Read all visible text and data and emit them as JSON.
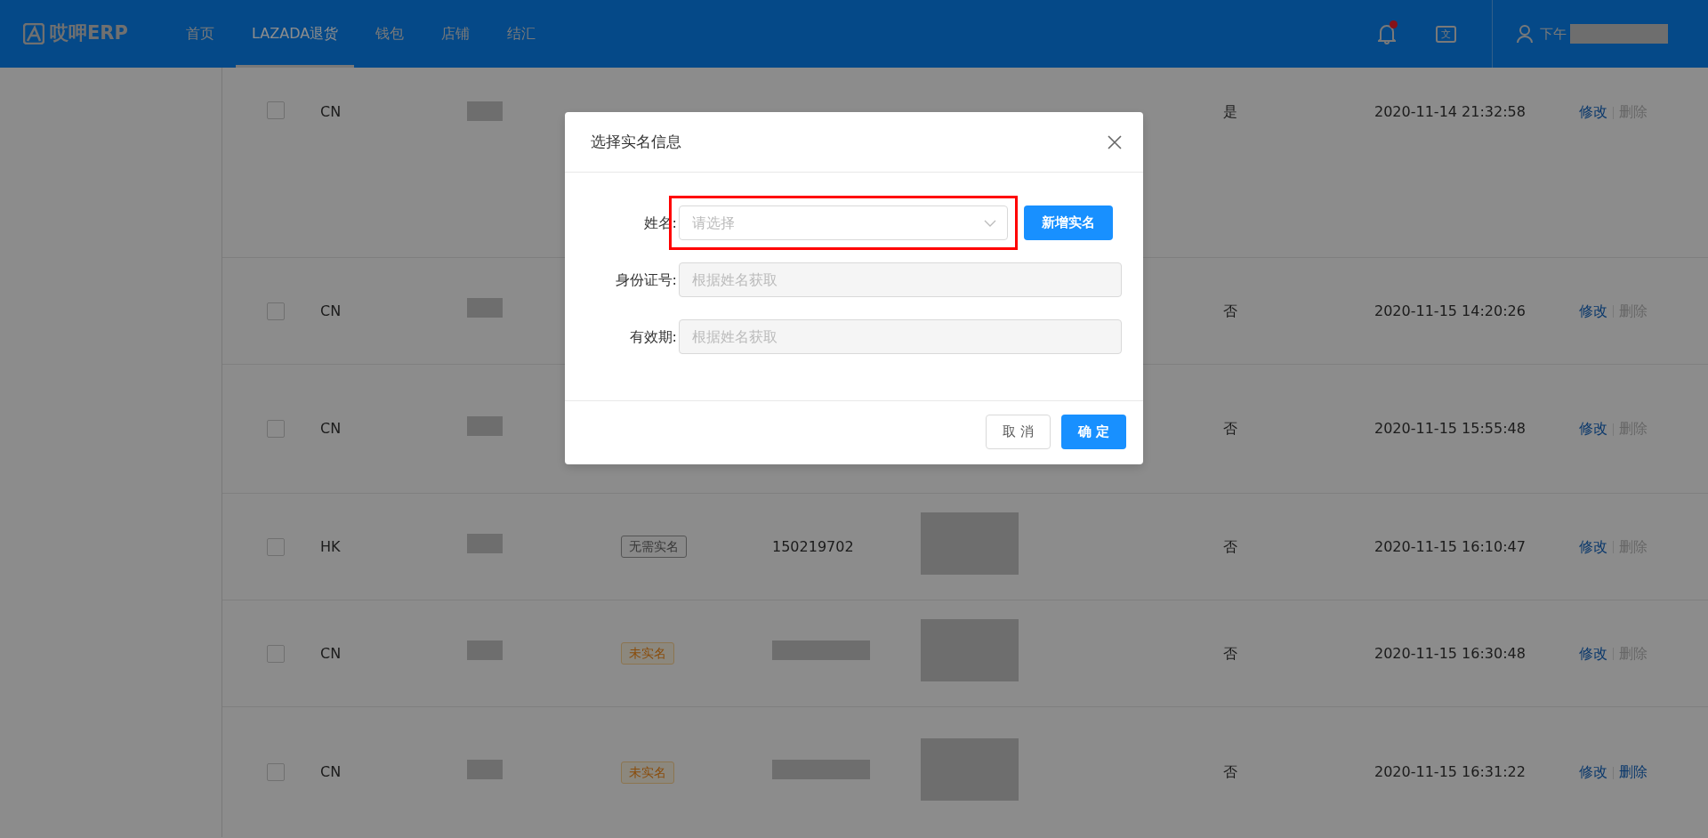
{
  "header": {
    "logo": "哎呷ERP",
    "nav": [
      {
        "label": "首页",
        "selected": false
      },
      {
        "label": "LAZADA退货",
        "selected": true
      },
      {
        "label": "钱包",
        "selected": false
      },
      {
        "label": "店铺",
        "selected": false
      },
      {
        "label": "结汇",
        "selected": false
      }
    ],
    "notifications": {
      "unread": true
    },
    "language_glyph": "文",
    "user": "下午"
  },
  "table": {
    "rows": [
      {
        "checked": false,
        "country": "CN",
        "tag": null,
        "phone": null,
        "realname": "是",
        "time": "2020-11-14 21:32:58",
        "edit": "修改",
        "delete": {
          "label": "删除",
          "disabled": true
        }
      },
      {
        "checked": false,
        "country": "CN",
        "tag": null,
        "phone": null,
        "realname": "否",
        "time": "2020-11-15 14:20:26",
        "edit": "修改",
        "delete": {
          "label": "删除",
          "disabled": true
        }
      },
      {
        "checked": false,
        "country": "CN",
        "tag": null,
        "phone": null,
        "realname": "否",
        "time": "2020-11-15 15:55:48",
        "edit": "修改",
        "delete": {
          "label": "删除",
          "disabled": true
        }
      },
      {
        "checked": false,
        "country": "HK",
        "tag": {
          "label": "无需实名",
          "kind": "neutral"
        },
        "phone": "150219702",
        "realname": "否",
        "time": "2020-11-15 16:10:47",
        "edit": "修改",
        "delete": {
          "label": "删除",
          "disabled": true
        }
      },
      {
        "checked": false,
        "country": "CN",
        "tag": {
          "label": "未实名",
          "kind": "warning"
        },
        "phone": null,
        "realname": "否",
        "time": "2020-11-15 16:30:48",
        "edit": "修改",
        "delete": {
          "label": "删除",
          "disabled": true
        }
      },
      {
        "checked": false,
        "country": "CN",
        "tag": {
          "label": "未实名",
          "kind": "warning"
        },
        "phone": null,
        "realname": "否",
        "time": "2020-11-15 16:31:22",
        "edit": "修改",
        "delete": {
          "label": "删除",
          "disabled": false
        }
      }
    ]
  },
  "dialog": {
    "title": "选择实名信息",
    "fields": [
      {
        "label": "姓名:",
        "kind": "select",
        "placeholder": "请选择",
        "highlighted": true
      },
      {
        "label": "身份证号:",
        "kind": "input",
        "placeholder": "根据姓名获取",
        "disabled": true
      },
      {
        "label": "有效期:",
        "kind": "input",
        "placeholder": "根据姓名获取",
        "disabled": true
      }
    ],
    "add_button": "新增实名",
    "cancel": "取 消",
    "confirm": "确 定"
  }
}
